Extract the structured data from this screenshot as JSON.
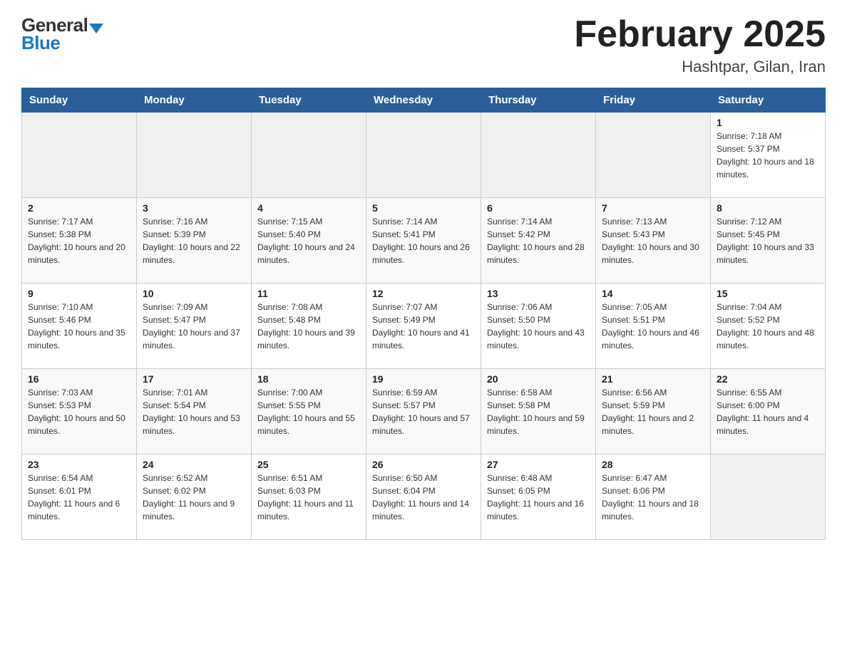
{
  "header": {
    "logo_general": "General",
    "logo_blue": "Blue",
    "month_title": "February 2025",
    "location": "Hashtpar, Gilan, Iran"
  },
  "days_of_week": [
    "Sunday",
    "Monday",
    "Tuesday",
    "Wednesday",
    "Thursday",
    "Friday",
    "Saturday"
  ],
  "weeks": [
    [
      {
        "day": "",
        "info": ""
      },
      {
        "day": "",
        "info": ""
      },
      {
        "day": "",
        "info": ""
      },
      {
        "day": "",
        "info": ""
      },
      {
        "day": "",
        "info": ""
      },
      {
        "day": "",
        "info": ""
      },
      {
        "day": "1",
        "info": "Sunrise: 7:18 AM\nSunset: 5:37 PM\nDaylight: 10 hours and 18 minutes."
      }
    ],
    [
      {
        "day": "2",
        "info": "Sunrise: 7:17 AM\nSunset: 5:38 PM\nDaylight: 10 hours and 20 minutes."
      },
      {
        "day": "3",
        "info": "Sunrise: 7:16 AM\nSunset: 5:39 PM\nDaylight: 10 hours and 22 minutes."
      },
      {
        "day": "4",
        "info": "Sunrise: 7:15 AM\nSunset: 5:40 PM\nDaylight: 10 hours and 24 minutes."
      },
      {
        "day": "5",
        "info": "Sunrise: 7:14 AM\nSunset: 5:41 PM\nDaylight: 10 hours and 26 minutes."
      },
      {
        "day": "6",
        "info": "Sunrise: 7:14 AM\nSunset: 5:42 PM\nDaylight: 10 hours and 28 minutes."
      },
      {
        "day": "7",
        "info": "Sunrise: 7:13 AM\nSunset: 5:43 PM\nDaylight: 10 hours and 30 minutes."
      },
      {
        "day": "8",
        "info": "Sunrise: 7:12 AM\nSunset: 5:45 PM\nDaylight: 10 hours and 33 minutes."
      }
    ],
    [
      {
        "day": "9",
        "info": "Sunrise: 7:10 AM\nSunset: 5:46 PM\nDaylight: 10 hours and 35 minutes."
      },
      {
        "day": "10",
        "info": "Sunrise: 7:09 AM\nSunset: 5:47 PM\nDaylight: 10 hours and 37 minutes."
      },
      {
        "day": "11",
        "info": "Sunrise: 7:08 AM\nSunset: 5:48 PM\nDaylight: 10 hours and 39 minutes."
      },
      {
        "day": "12",
        "info": "Sunrise: 7:07 AM\nSunset: 5:49 PM\nDaylight: 10 hours and 41 minutes."
      },
      {
        "day": "13",
        "info": "Sunrise: 7:06 AM\nSunset: 5:50 PM\nDaylight: 10 hours and 43 minutes."
      },
      {
        "day": "14",
        "info": "Sunrise: 7:05 AM\nSunset: 5:51 PM\nDaylight: 10 hours and 46 minutes."
      },
      {
        "day": "15",
        "info": "Sunrise: 7:04 AM\nSunset: 5:52 PM\nDaylight: 10 hours and 48 minutes."
      }
    ],
    [
      {
        "day": "16",
        "info": "Sunrise: 7:03 AM\nSunset: 5:53 PM\nDaylight: 10 hours and 50 minutes."
      },
      {
        "day": "17",
        "info": "Sunrise: 7:01 AM\nSunset: 5:54 PM\nDaylight: 10 hours and 53 minutes."
      },
      {
        "day": "18",
        "info": "Sunrise: 7:00 AM\nSunset: 5:55 PM\nDaylight: 10 hours and 55 minutes."
      },
      {
        "day": "19",
        "info": "Sunrise: 6:59 AM\nSunset: 5:57 PM\nDaylight: 10 hours and 57 minutes."
      },
      {
        "day": "20",
        "info": "Sunrise: 6:58 AM\nSunset: 5:58 PM\nDaylight: 10 hours and 59 minutes."
      },
      {
        "day": "21",
        "info": "Sunrise: 6:56 AM\nSunset: 5:59 PM\nDaylight: 11 hours and 2 minutes."
      },
      {
        "day": "22",
        "info": "Sunrise: 6:55 AM\nSunset: 6:00 PM\nDaylight: 11 hours and 4 minutes."
      }
    ],
    [
      {
        "day": "23",
        "info": "Sunrise: 6:54 AM\nSunset: 6:01 PM\nDaylight: 11 hours and 6 minutes."
      },
      {
        "day": "24",
        "info": "Sunrise: 6:52 AM\nSunset: 6:02 PM\nDaylight: 11 hours and 9 minutes."
      },
      {
        "day": "25",
        "info": "Sunrise: 6:51 AM\nSunset: 6:03 PM\nDaylight: 11 hours and 11 minutes."
      },
      {
        "day": "26",
        "info": "Sunrise: 6:50 AM\nSunset: 6:04 PM\nDaylight: 11 hours and 14 minutes."
      },
      {
        "day": "27",
        "info": "Sunrise: 6:48 AM\nSunset: 6:05 PM\nDaylight: 11 hours and 16 minutes."
      },
      {
        "day": "28",
        "info": "Sunrise: 6:47 AM\nSunset: 6:06 PM\nDaylight: 11 hours and 18 minutes."
      },
      {
        "day": "",
        "info": ""
      }
    ]
  ]
}
